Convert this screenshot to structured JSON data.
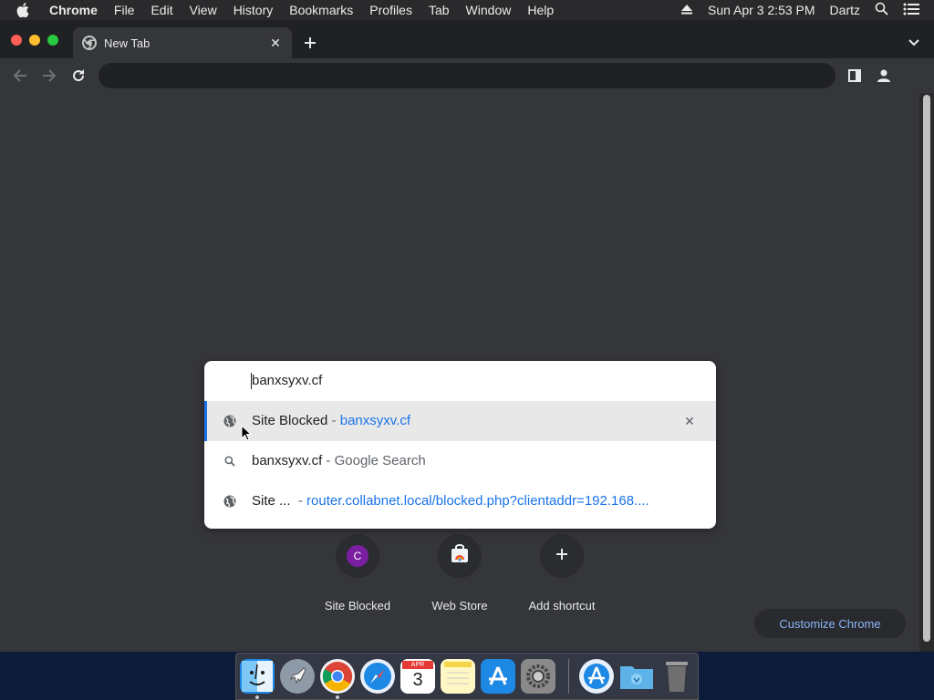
{
  "menubar": {
    "apple_icon": "apple-logo-icon",
    "items": [
      "Chrome",
      "File",
      "Edit",
      "View",
      "History",
      "Bookmarks",
      "Profiles",
      "Tab",
      "Window",
      "Help"
    ],
    "datetime": "Sun Apr 3  2:53 PM",
    "user": "Dartz"
  },
  "tab": {
    "title": "New Tab"
  },
  "omnibox_dropdown": {
    "input_value": "banxsyxv.cf",
    "suggestions": [
      {
        "icon": "globe-icon",
        "title": "Site Blocked",
        "separator": " - ",
        "detail": "banxsyxv.cf",
        "selected": true
      },
      {
        "icon": "search-icon",
        "title": "banxsyxv.cf",
        "separator": " - ",
        "detail": "Google Search",
        "selected": false
      },
      {
        "icon": "globe-icon",
        "title": "Site ...",
        "separator": "  - ",
        "detail": "router.collabnet.local/blocked.php?clientaddr=192.168....",
        "selected": false
      }
    ]
  },
  "shortcuts": [
    {
      "label": "Site Blocked",
      "icon_letter": "C"
    },
    {
      "label": "Web Store",
      "icon": "web-store-icon"
    },
    {
      "label": "Add shortcut",
      "icon": "plus-icon"
    }
  ],
  "customize_button": "Customize Chrome",
  "calendar": {
    "month": "APR",
    "day": "3"
  },
  "colors": {
    "accent": "#1a73e8",
    "link": "#8ab4f8",
    "page_bg": "#35363a"
  }
}
